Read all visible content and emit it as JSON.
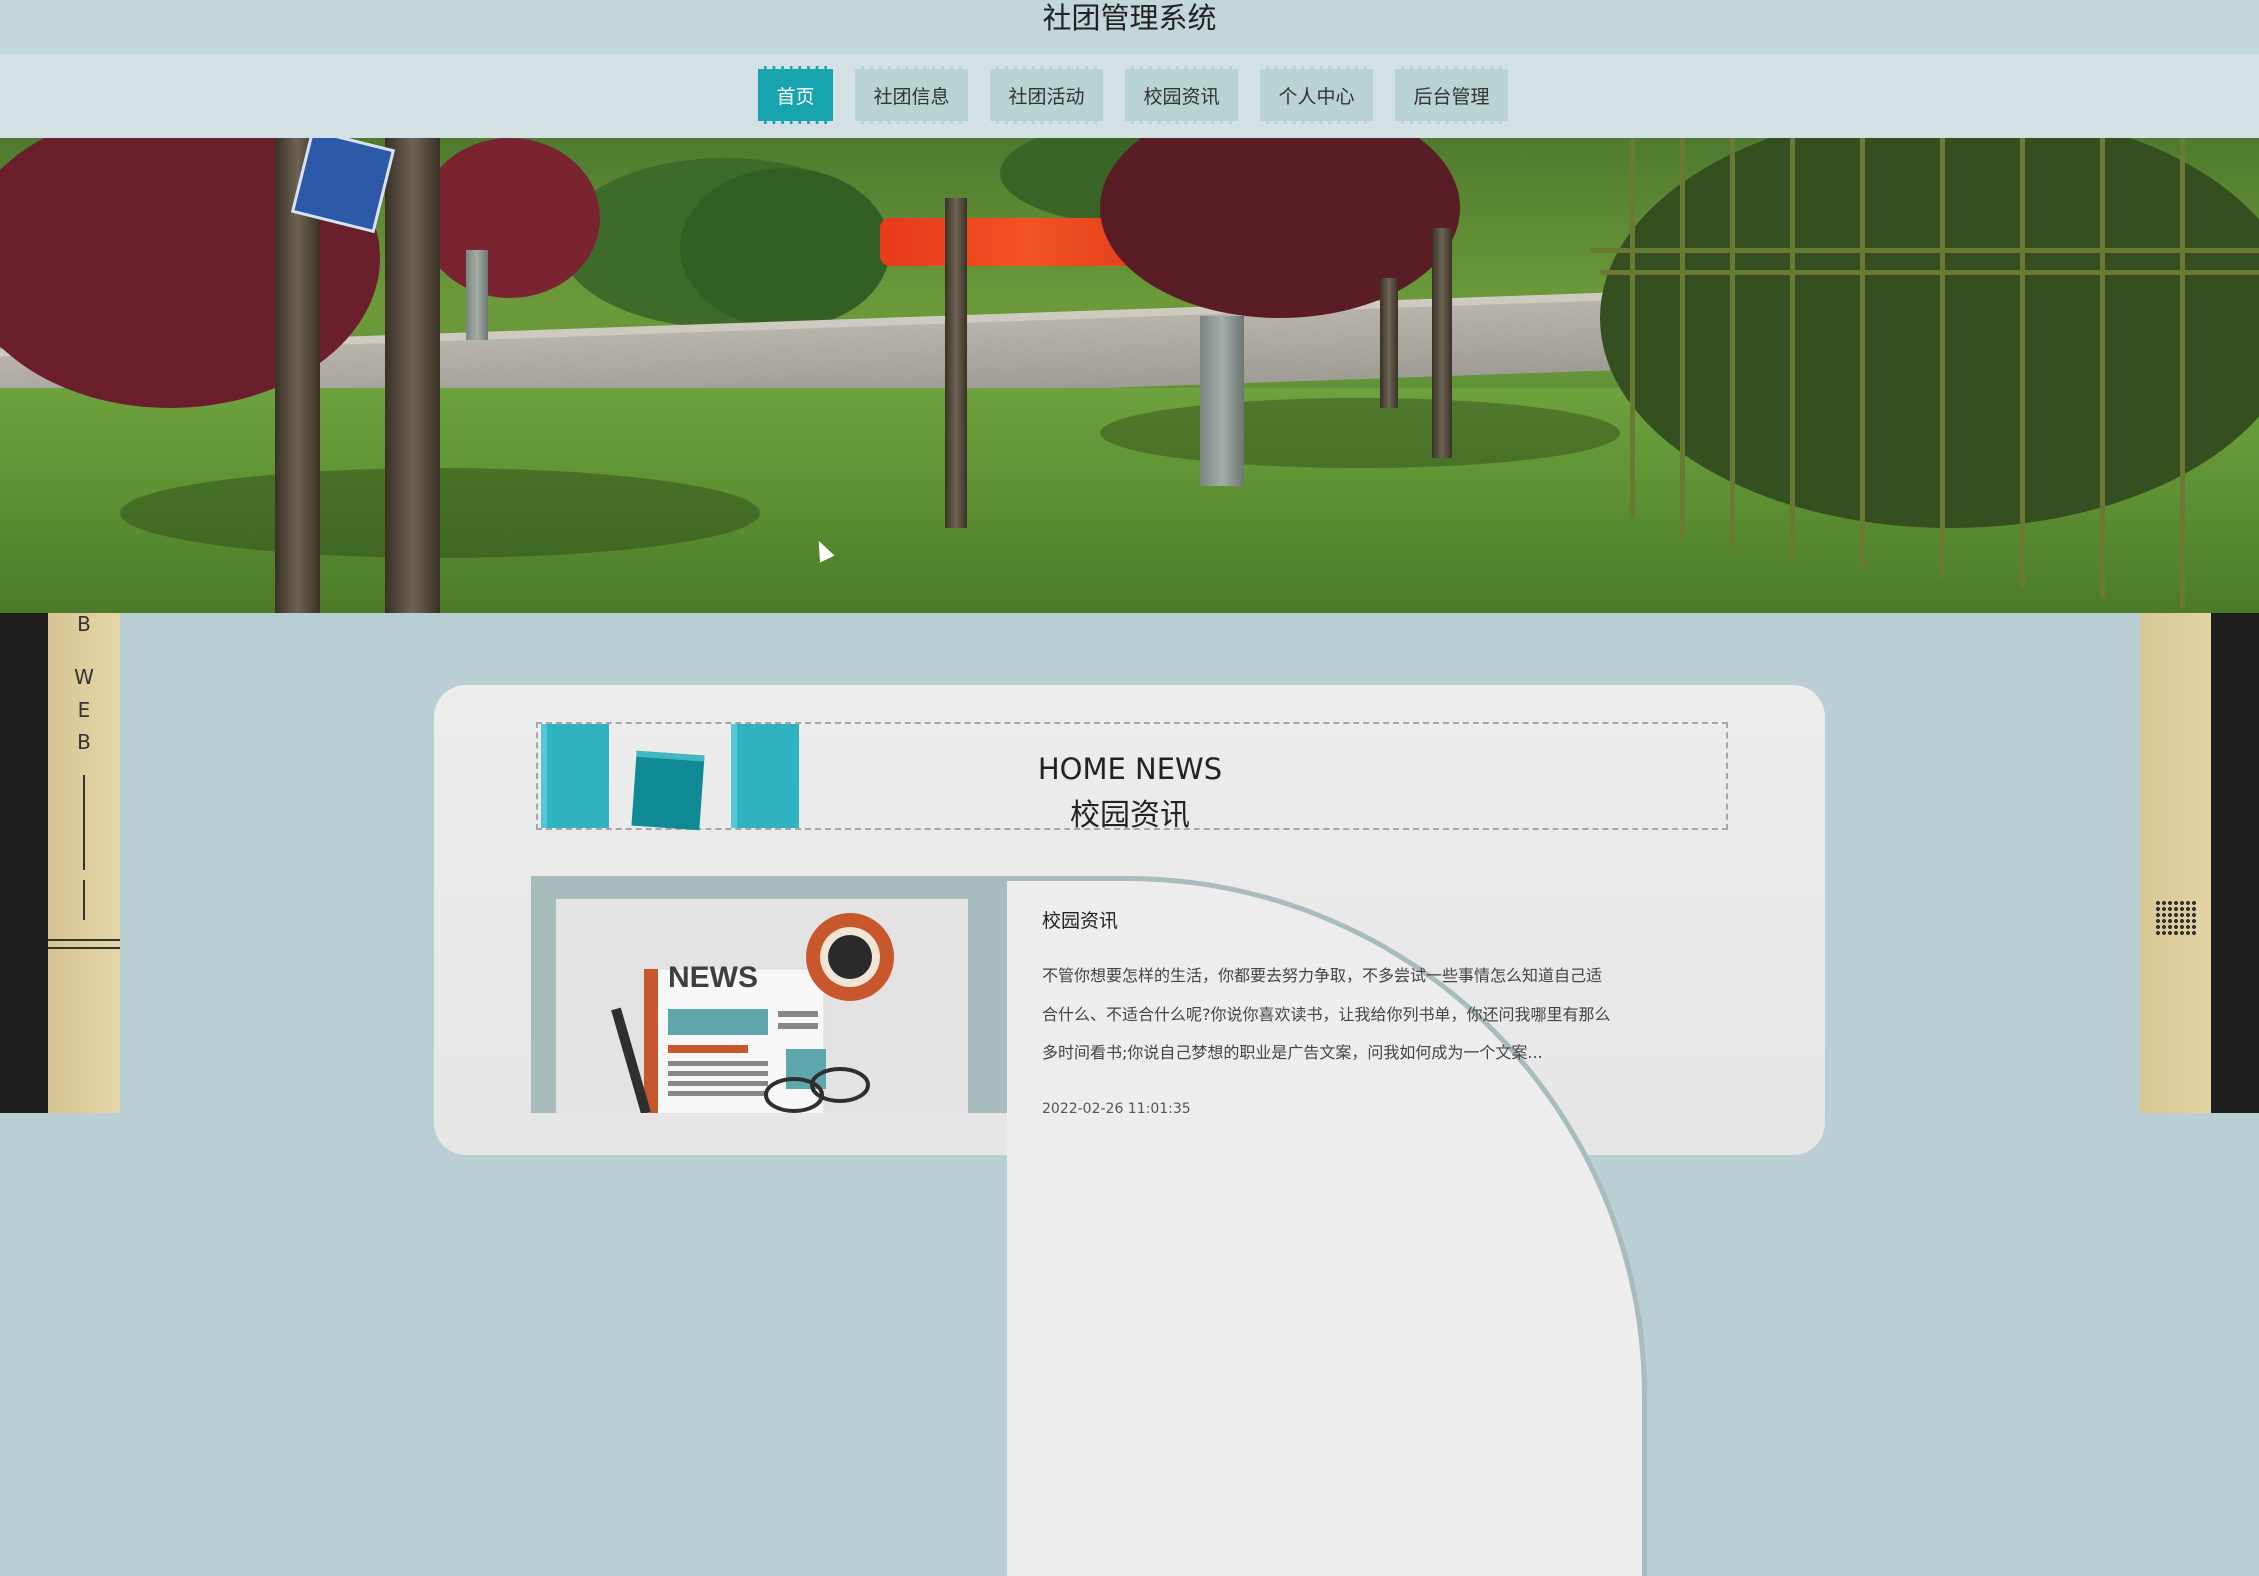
{
  "header": {
    "title": "社团管理系统"
  },
  "nav": {
    "items": [
      {
        "label": "首页",
        "active": true
      },
      {
        "label": "社团信息",
        "active": false
      },
      {
        "label": "社团活动",
        "active": false
      },
      {
        "label": "校园资讯",
        "active": false
      },
      {
        "label": "个人中心",
        "active": false
      },
      {
        "label": "后台管理",
        "active": false
      }
    ]
  },
  "side_left": {
    "letters": [
      "B",
      "W",
      "E",
      "B"
    ]
  },
  "news_section": {
    "title_en": "HOME NEWS",
    "title_cn": "校园资讯"
  },
  "news_item": {
    "image_text": "NEWS",
    "title": "校园资讯",
    "body": "不管你想要怎样的生活，你都要去努力争取，不多尝试一些事情怎么知道自己适合什么、不适合什么呢?你说你喜欢读书，让我给你列书单，你还问我哪里有那么多时间看书;你说自己梦想的职业是广告文案，问我如何成为一个文案...",
    "date": "2022-02-26 11:01:35"
  },
  "colors": {
    "accent": "#17a4ae",
    "nav_item_bg": "#b8d3d1",
    "gold": "#d6c592"
  },
  "icons": [
    "grid-dots-icon",
    "cube-icon",
    "mouse-cursor-icon"
  ]
}
